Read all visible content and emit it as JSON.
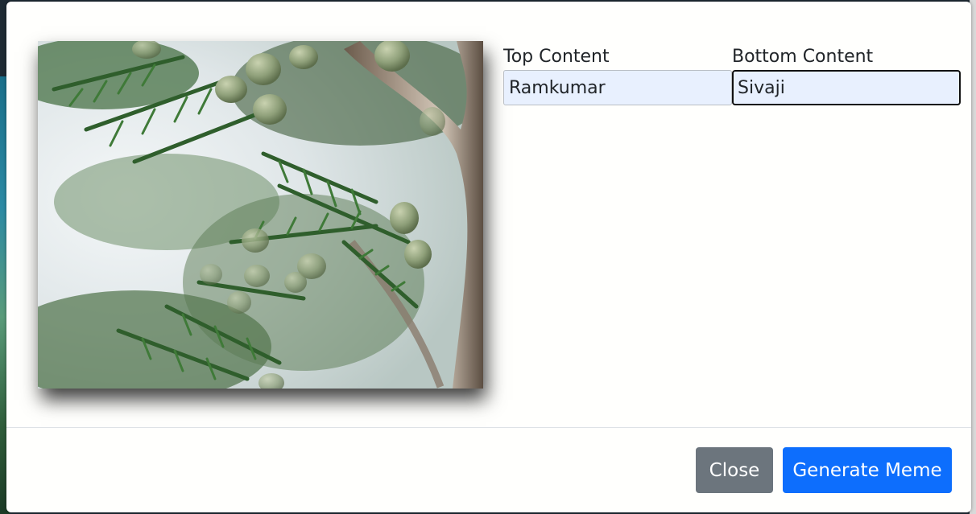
{
  "form": {
    "top_label": "Top Content",
    "top_value": "Ramkumar",
    "bottom_label": "Bottom Content",
    "bottom_value": "Sivaji"
  },
  "footer": {
    "close_label": "Close",
    "generate_label": "Generate Meme"
  },
  "colors": {
    "close_button": "#6c757d",
    "primary_button": "#0d6efd",
    "input_autofill": "#e8f0fe"
  },
  "icons": []
}
